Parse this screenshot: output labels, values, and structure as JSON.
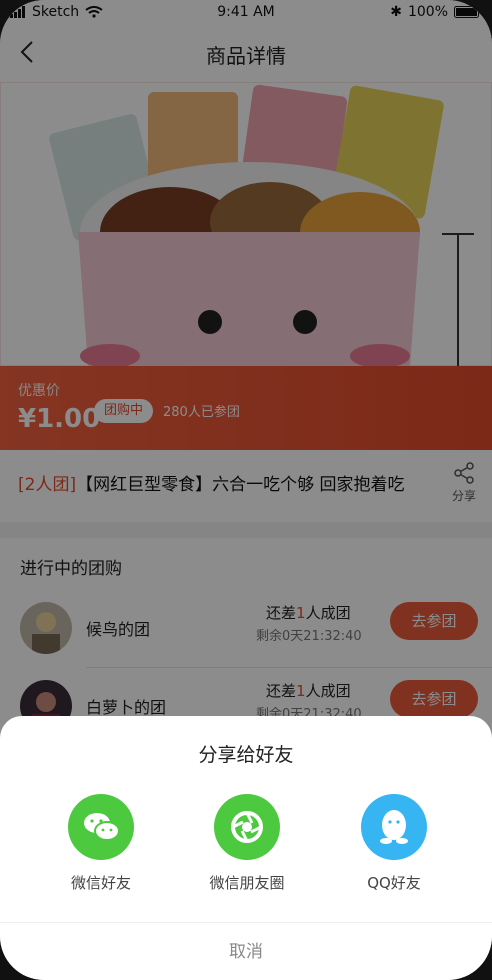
{
  "status_bar": {
    "carrier": "Sketch",
    "time": "9:41 AM",
    "battery": "100%"
  },
  "nav": {
    "title": "商品详情"
  },
  "price_section": {
    "label": "优惠价",
    "price": "¥1.00",
    "tag": "团购中",
    "joined": "280人已参团"
  },
  "product": {
    "group_tag": "[2人团]",
    "title": "【网红巨型零食】六合一吃个够 回家抱着吃"
  },
  "share_label": "分享",
  "groups": {
    "title": "进行中的团购",
    "items": [
      {
        "name": "候鸟的团",
        "need_prefix": "还差",
        "need_num": "1",
        "need_suffix": "人成团",
        "remaining": "剩余0天21:32:40",
        "button": "去参团"
      },
      {
        "name": "白萝卜的团",
        "need_prefix": "还差",
        "need_num": "1",
        "need_suffix": "人成团",
        "remaining": "剩余0天21:32:40",
        "button": "去参团"
      }
    ]
  },
  "share_sheet": {
    "title": "分享给好友",
    "options": [
      {
        "label": "微信好友",
        "icon": "wechat-icon",
        "color": "#4cc93f"
      },
      {
        "label": "微信朋友圈",
        "icon": "moments-icon",
        "color": "#4cc93f"
      },
      {
        "label": "QQ好友",
        "icon": "qq-icon",
        "color": "#36b5f2"
      }
    ],
    "cancel": "取消"
  },
  "colors": {
    "accent": "#e34b2d",
    "wechat": "#4cc93f",
    "qq": "#36b5f2"
  }
}
